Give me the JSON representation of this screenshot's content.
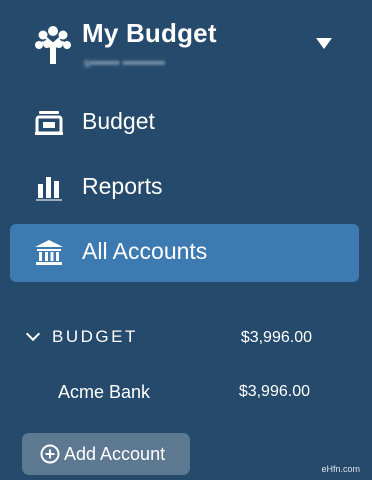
{
  "header": {
    "title": "My Budget",
    "email": "s••••••• ••••••••••"
  },
  "nav": {
    "items": [
      {
        "label": "Budget",
        "icon": "bank-note-icon"
      },
      {
        "label": "Reports",
        "icon": "bar-chart-icon"
      },
      {
        "label": "All Accounts",
        "icon": "bank-icon"
      }
    ]
  },
  "accounts": {
    "section_title": "BUDGET",
    "section_total": "$3,996.00",
    "list": [
      {
        "name": "Acme Bank",
        "balance": "$3,996.00"
      }
    ],
    "add_label": "Add Account"
  },
  "watermark": "eHfn.com",
  "colors": {
    "background": "#254a6b",
    "active_item": "#3d7ab1",
    "add_button": "#5d7891"
  }
}
